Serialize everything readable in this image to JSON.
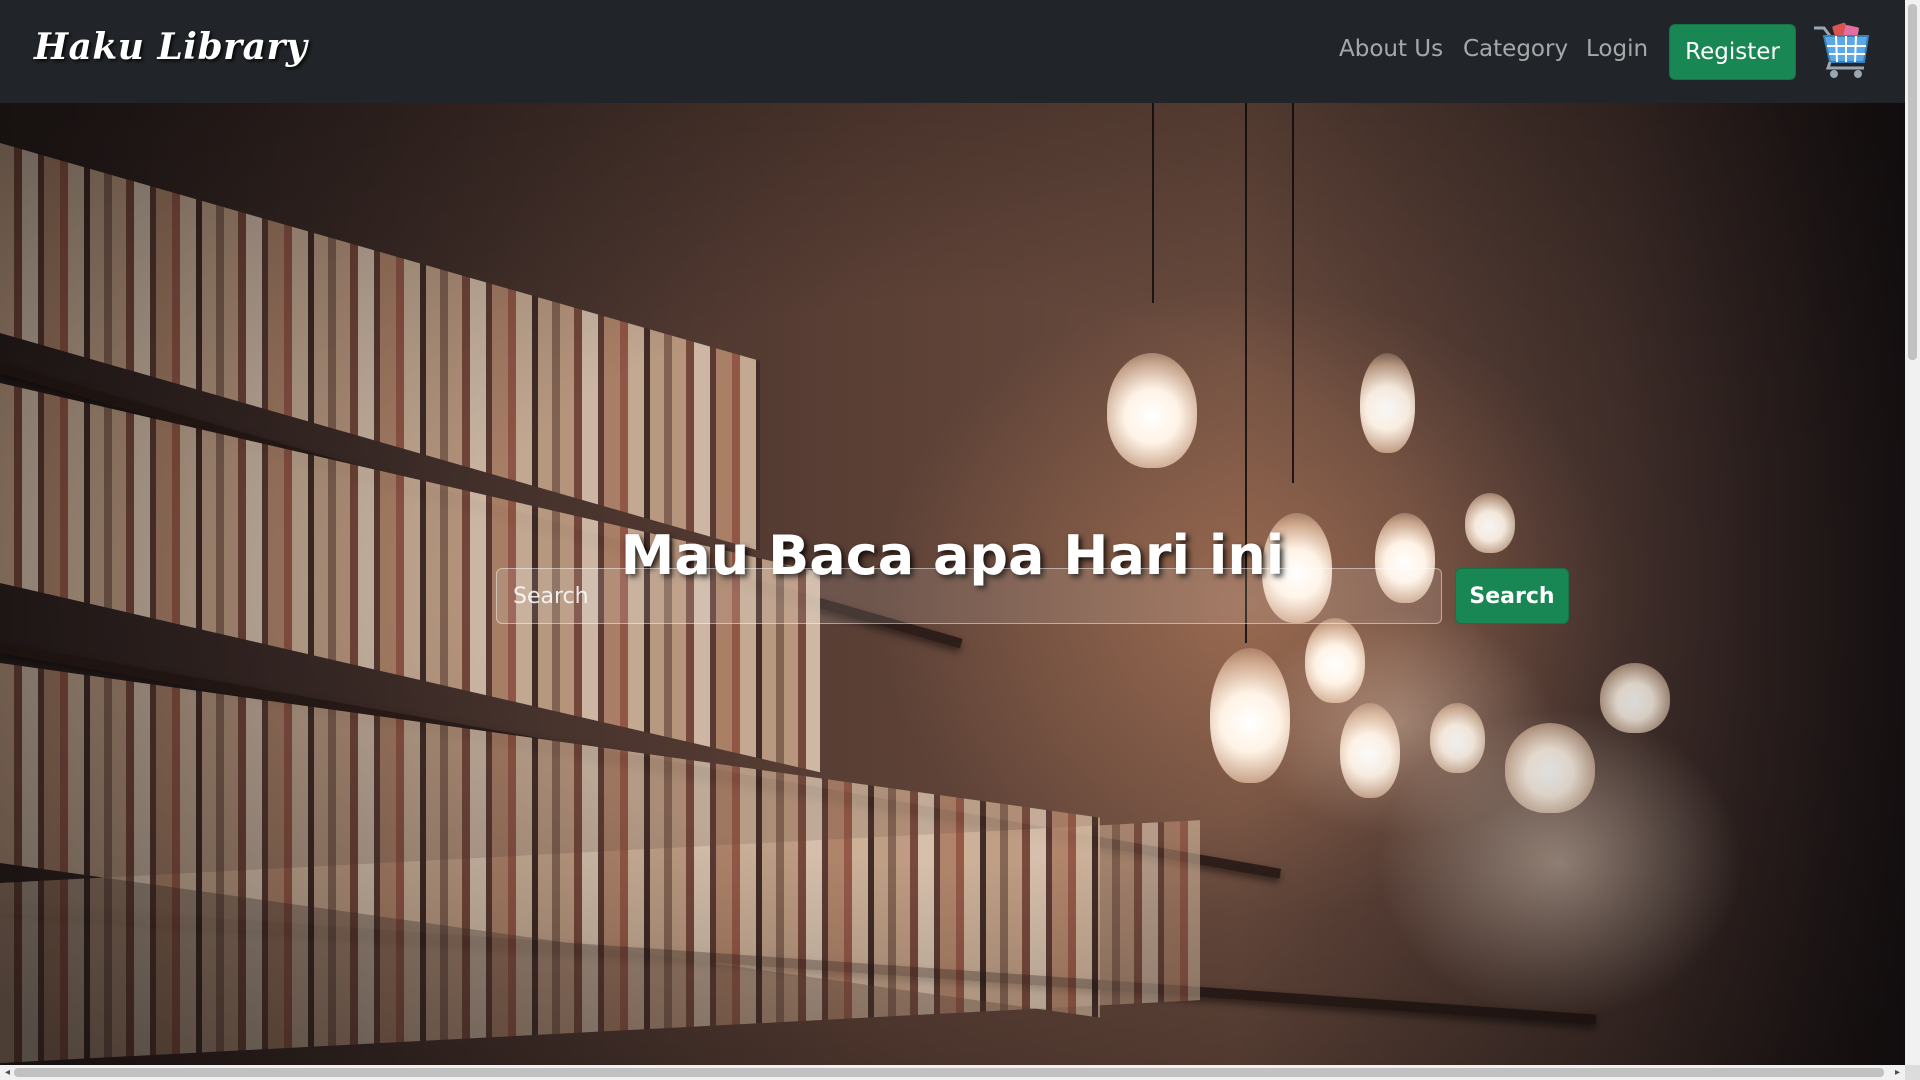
{
  "navbar": {
    "brand": "Haku Library",
    "links": [
      "About Us",
      "Category",
      "Login"
    ],
    "register_label": "Register",
    "cart_icon": "shopping-cart-icon"
  },
  "hero": {
    "title": "Mau Baca apa Hari ini",
    "search_placeholder": "Search",
    "search_button": "Search"
  },
  "colors": {
    "navbar_bg": "#212529",
    "accent_green": "#198754"
  }
}
